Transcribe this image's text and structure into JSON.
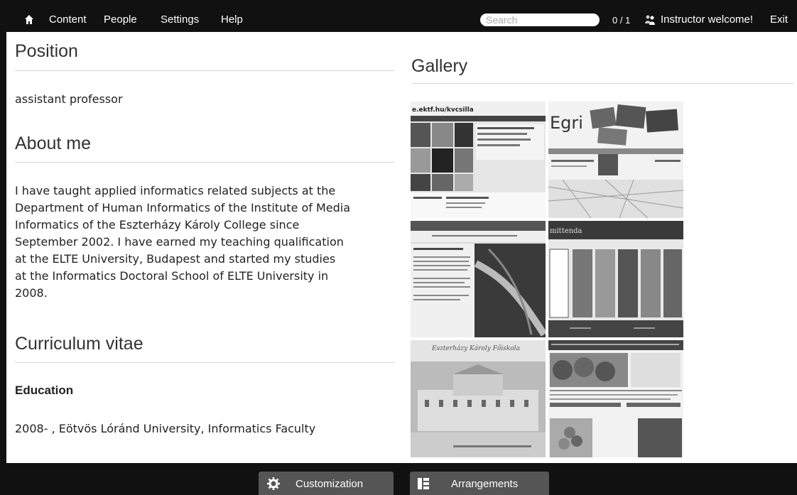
{
  "nav": {
    "content": "Content",
    "people": "People",
    "settings": "Settings",
    "help": "Help",
    "search_placeholder": "Search",
    "user_count": "0 / 1",
    "welcome": "Instructor welcome!",
    "exit": "Exit"
  },
  "profile": {
    "position_heading": "Position",
    "position_value": "assistant professor",
    "about_heading": "About me",
    "about_lines": [
      "I have taught applied informatics related subjects at the",
      "Department of Human Informatics of the Institute of Media",
      "Informatics of the Eszterházy Károly College since",
      "September 2002. I have earned my teaching qualification",
      "at the ELTE University, Budapest and started my studies",
      "at the Informatics Doctoral School of ELTE University in",
      "2008."
    ],
    "cv_heading": "Curriculum vitae",
    "education_heading": "Education",
    "education_item": "2008- , Eötvös Lóránd University, Informatics Faculty"
  },
  "gallery": {
    "title": "Gallery",
    "thumb1_url": "e.ektf.hu/kvcsilla",
    "thumb2_logo": "Egri",
    "thumb4_header": "mittenda",
    "thumb5_caption": "Eszterházy Károly Főiskola"
  },
  "bottom": {
    "customization": "Customization",
    "arrangements": "Arrangements"
  },
  "icons": {
    "home": "home-icon",
    "users": "users-icon",
    "gear": "gear-icon",
    "arrange": "arrangements-icon"
  }
}
